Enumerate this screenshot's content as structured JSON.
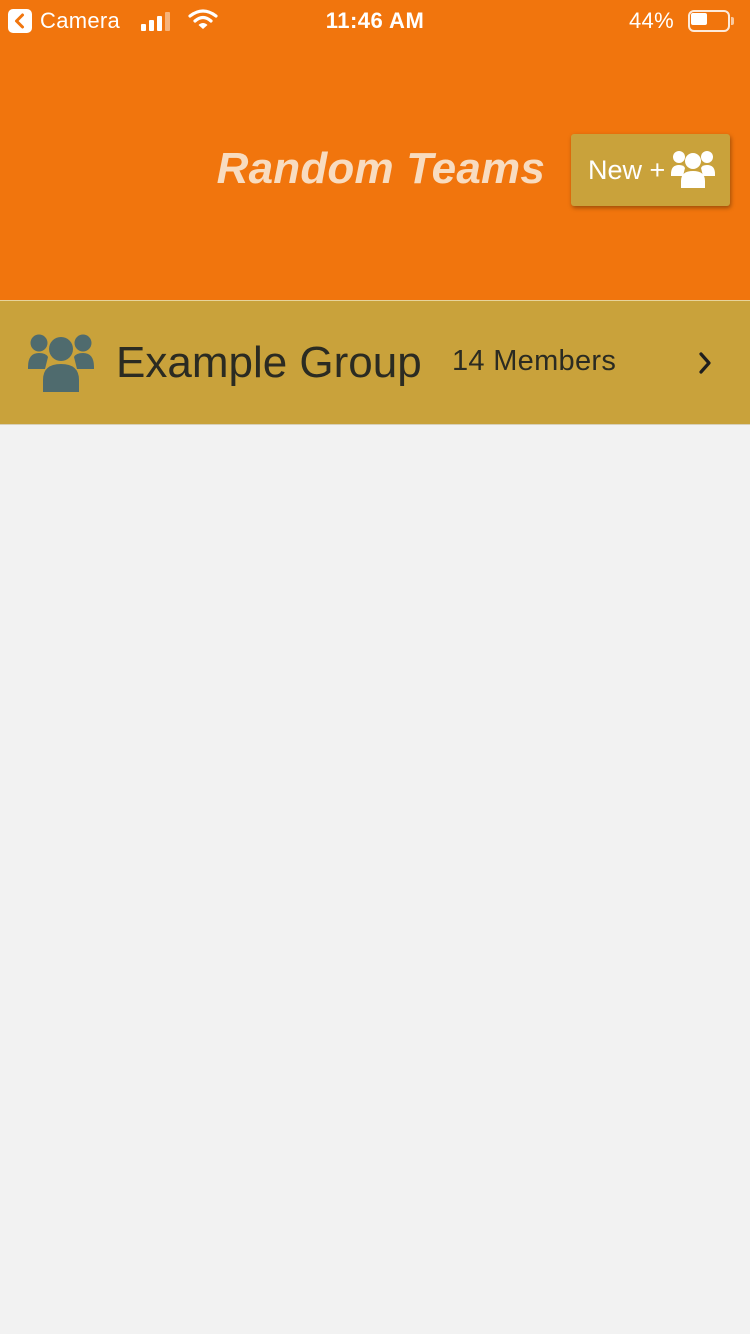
{
  "status_bar": {
    "back_label": "Camera",
    "time": "11:46 AM",
    "battery_percent_text": "44%",
    "battery_level": 0.44,
    "signal_bars": 3
  },
  "header": {
    "title": "Random Teams",
    "new_button_label": "New +",
    "new_button_icon": "group-icon"
  },
  "groups": [
    {
      "icon": "group-icon",
      "name": "Example Group",
      "members_text": "14 Members",
      "chevron_icon": "chevron-right-icon"
    }
  ],
  "colors": {
    "header_bg": "#f1750d",
    "title_text": "#f8dcc0",
    "accent_gold": "#c9a23b",
    "group_icon": "#4f6b6e",
    "page_bg": "#f2f2f2"
  }
}
